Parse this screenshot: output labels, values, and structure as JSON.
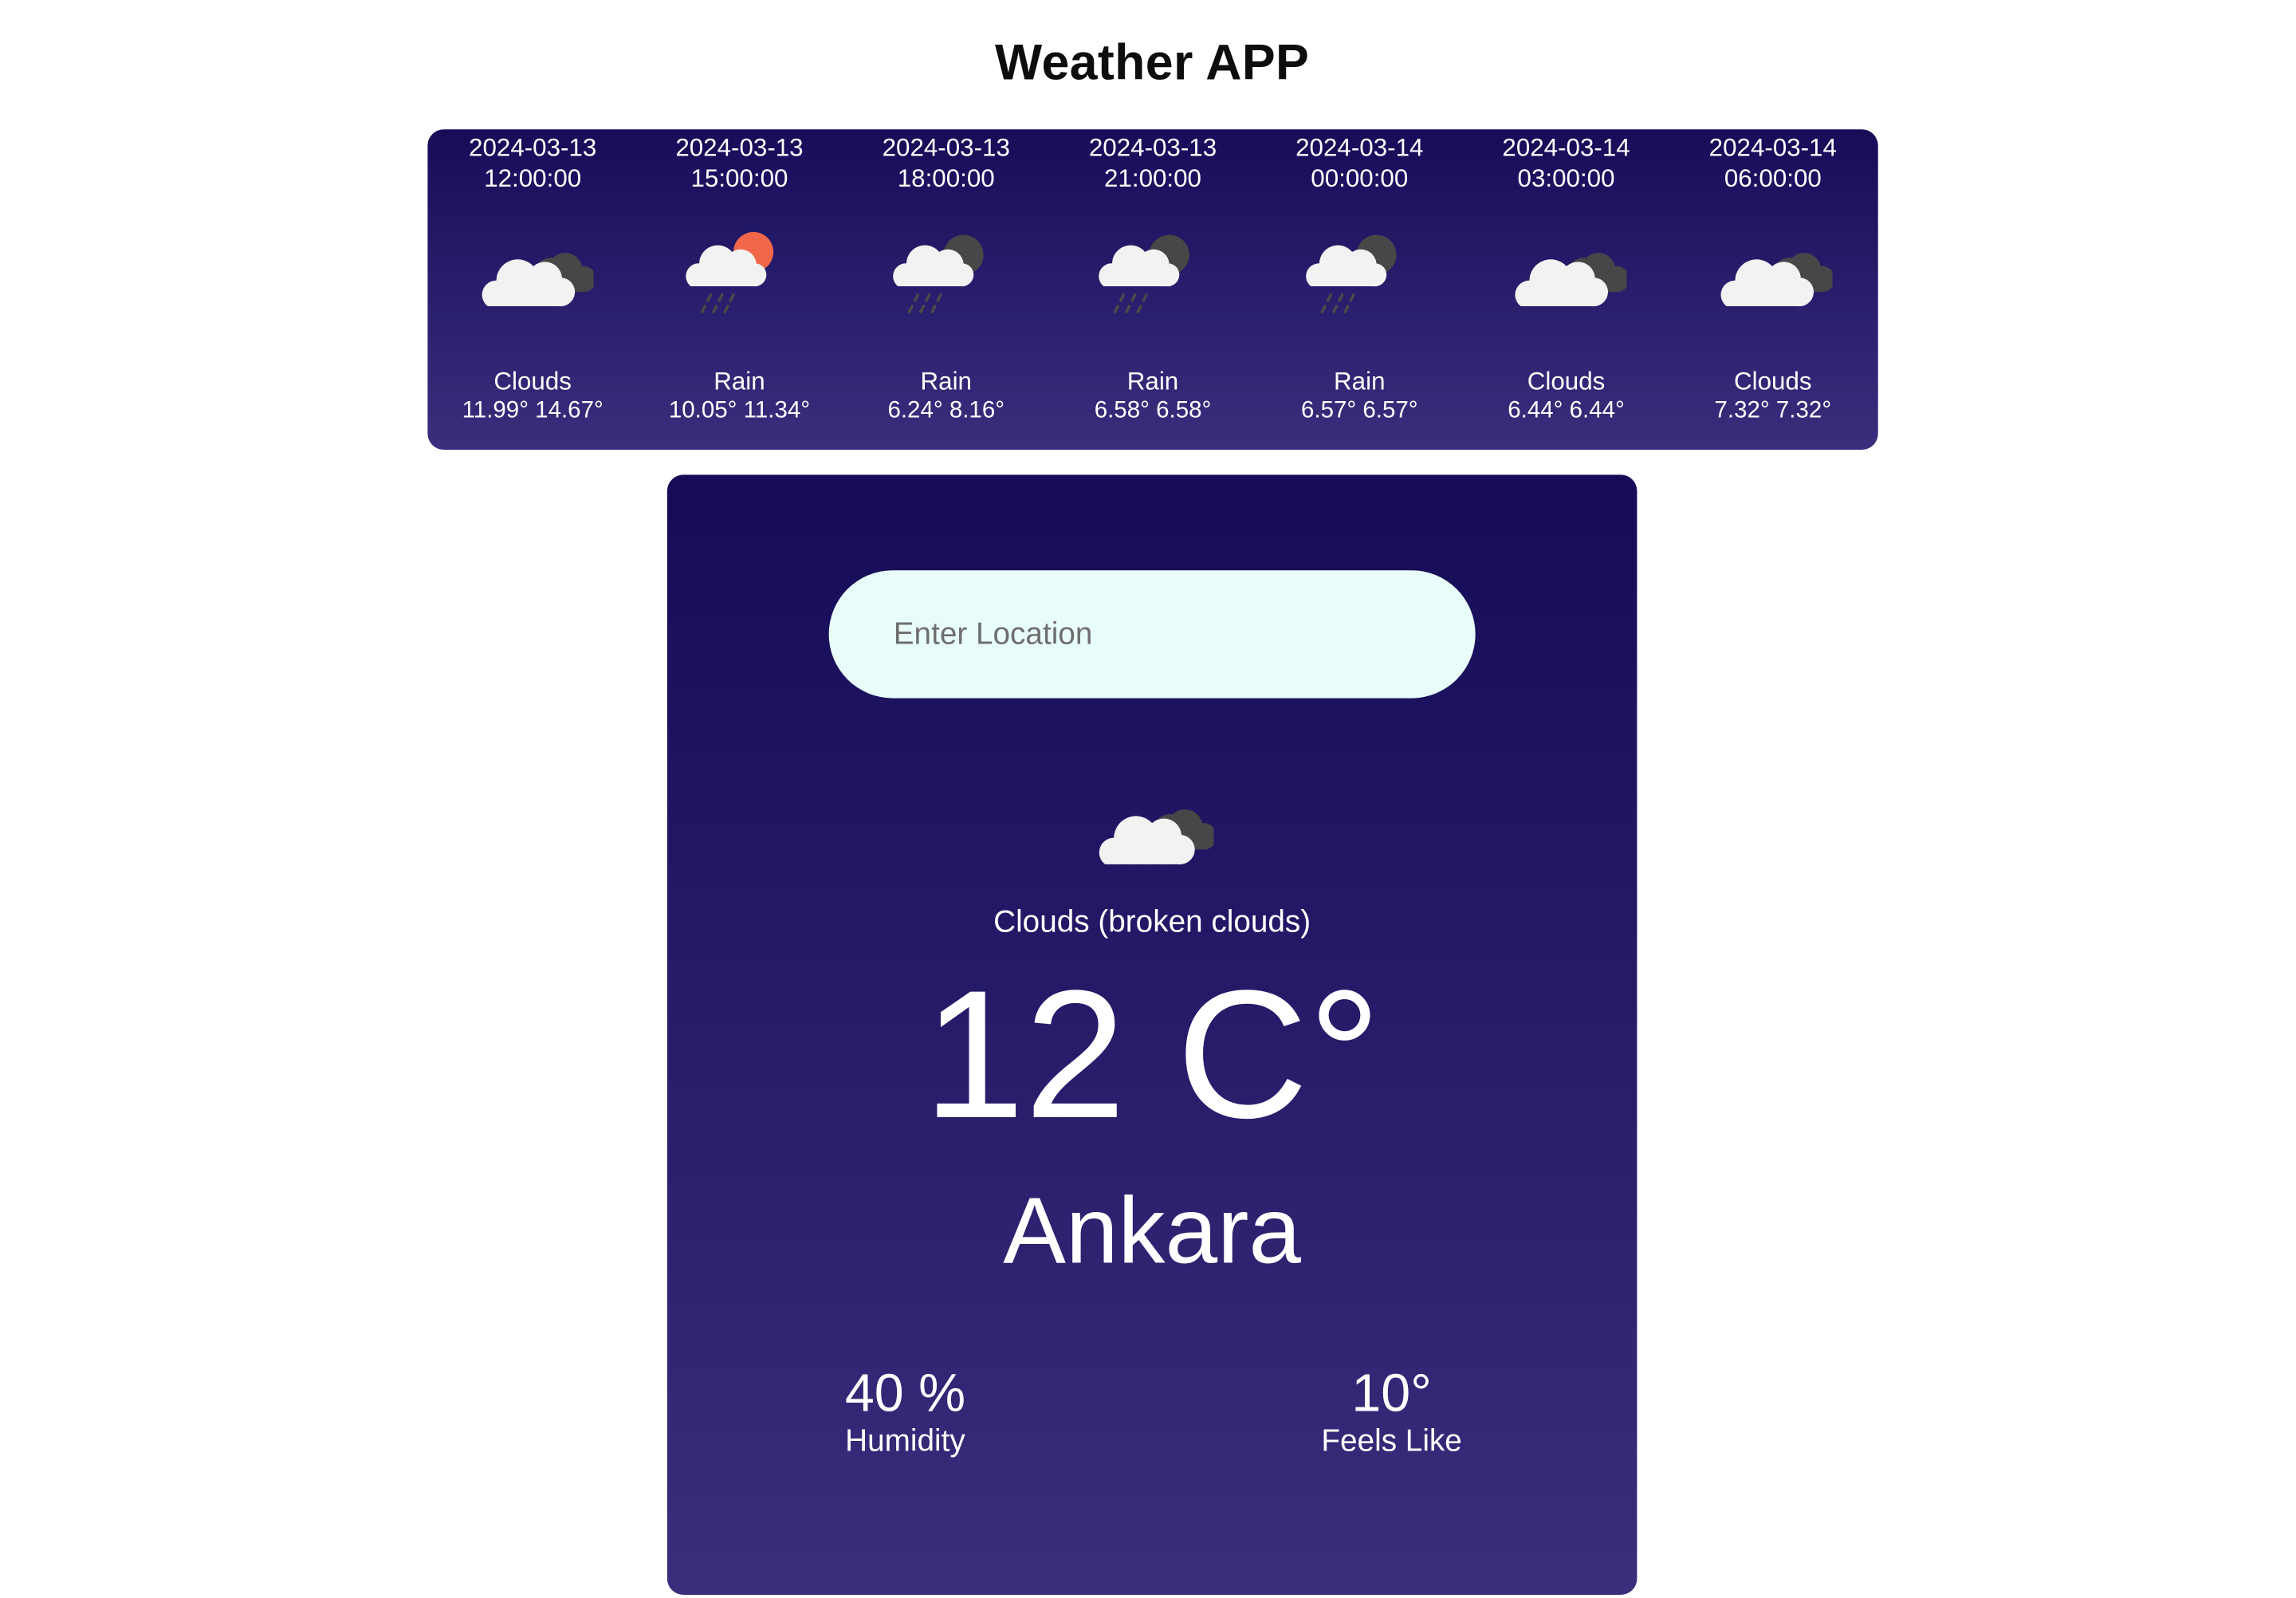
{
  "app": {
    "title": "Weather APP"
  },
  "forecast": [
    {
      "date": "2024-03-13",
      "time": "12:00:00",
      "icon": "clouds-icon",
      "condition": "Clouds",
      "temps": "11.99° 14.67°"
    },
    {
      "date": "2024-03-13",
      "time": "15:00:00",
      "icon": "rain-sun-icon",
      "condition": "Rain",
      "temps": "10.05° 11.34°"
    },
    {
      "date": "2024-03-13",
      "time": "18:00:00",
      "icon": "rain-night-icon",
      "condition": "Rain",
      "temps": "6.24° 8.16°"
    },
    {
      "date": "2024-03-13",
      "time": "21:00:00",
      "icon": "rain-night-icon",
      "condition": "Rain",
      "temps": "6.58° 6.58°"
    },
    {
      "date": "2024-03-14",
      "time": "00:00:00",
      "icon": "rain-night-icon",
      "condition": "Rain",
      "temps": "6.57° 6.57°"
    },
    {
      "date": "2024-03-14",
      "time": "03:00:00",
      "icon": "clouds-icon",
      "condition": "Clouds",
      "temps": "6.44° 6.44°"
    },
    {
      "date": "2024-03-14",
      "time": "06:00:00",
      "icon": "clouds-icon",
      "condition": "Clouds",
      "temps": "7.32° 7.32°"
    }
  ],
  "search": {
    "placeholder": "Enter Location",
    "value": ""
  },
  "current": {
    "icon": "clouds-icon",
    "description": "Clouds (broken clouds)",
    "temperature": "12 C°",
    "city": "Ankara",
    "humidity_value": "40 %",
    "humidity_label": "Humidity",
    "feels_like_value": "10°",
    "feels_like_label": "Feels Like"
  },
  "colors": {
    "card_gradient_top": "#160b57",
    "card_gradient_bottom": "#3a2e7c",
    "search_background": "#e8fdf9",
    "sun_accent": "#f0674a"
  }
}
